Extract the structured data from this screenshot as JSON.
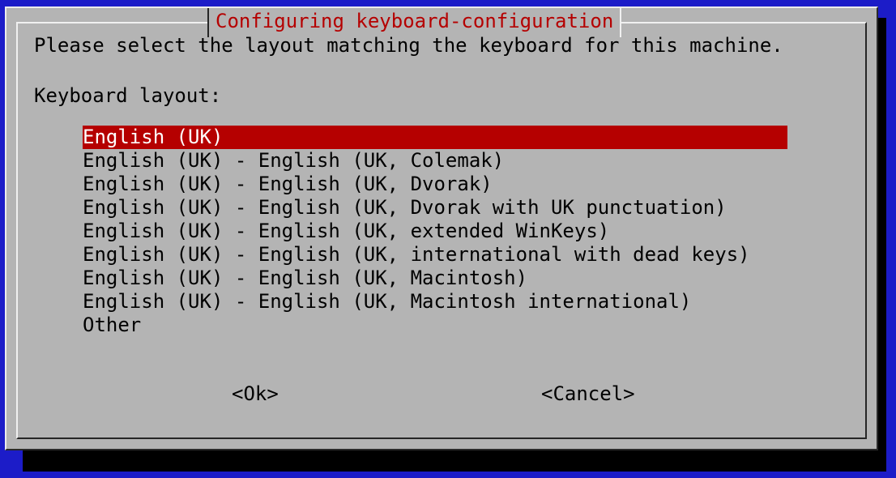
{
  "dialog": {
    "title": "Configuring keyboard-configuration",
    "prompt": "Please select the layout matching the keyboard for this machine.",
    "label": "Keyboard layout:",
    "items": [
      "English (UK)",
      "English (UK) - English (UK, Colemak)",
      "English (UK) - English (UK, Dvorak)",
      "English (UK) - English (UK, Dvorak with UK punctuation)",
      "English (UK) - English (UK, extended WinKeys)",
      "English (UK) - English (UK, international with dead keys)",
      "English (UK) - English (UK, Macintosh)",
      "English (UK) - English (UK, Macintosh international)",
      "Other"
    ],
    "selected_item": "English (UK)",
    "ok_label": "<Ok>",
    "cancel_label": "<Cancel>"
  },
  "colors": {
    "screen_background": "#1c1cc8",
    "dialog_background": "#b4b4b4",
    "title_text": "#b50000",
    "selection_background": "#b50000",
    "selection_text": "#ffffff"
  }
}
